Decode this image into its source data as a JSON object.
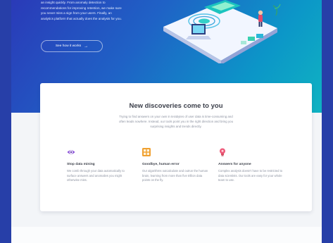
{
  "hero": {
    "intro_lines": [
      "an insight quickly. From anomaly detection to",
      "recommendations for improving retention, we make sure",
      "you never miss a sign from your users. Finally, an",
      "analytics platform that actually does the analysis for you."
    ],
    "cta_label": "See how it works",
    "cta_arrow": "→"
  },
  "discoveries": {
    "title": "New discoveries come to you",
    "body": "Trying to find answers on your own in terabytes of user data is time-consuming and often leads nowhere. Instead, our tools point you in the right direction and bring you surprising insights and trends directly.",
    "features": [
      {
        "icon": "eye-icon",
        "title": "Stop data mining",
        "text": "We comb through your data automatically to surface answers and anomalies you might otherwise miss."
      },
      {
        "icon": "grid-icon",
        "title": "Goodbye, human error",
        "text": "Our algorithms outcalculate and outrun the human brain, learning from more than five trillion data points on the fly."
      },
      {
        "icon": "lightbulb-icon",
        "title": "Answers for anyone",
        "text": "Complex analysis doesn't have to be restricted to data scientists. Our tools are easy for your whole team to use."
      }
    ]
  },
  "colors": {
    "page_background": "#273fa8",
    "eye_icon": "#8d55d8",
    "grid_icon": "#f0a030",
    "lightbulb_icon": "#ee5a7a"
  }
}
